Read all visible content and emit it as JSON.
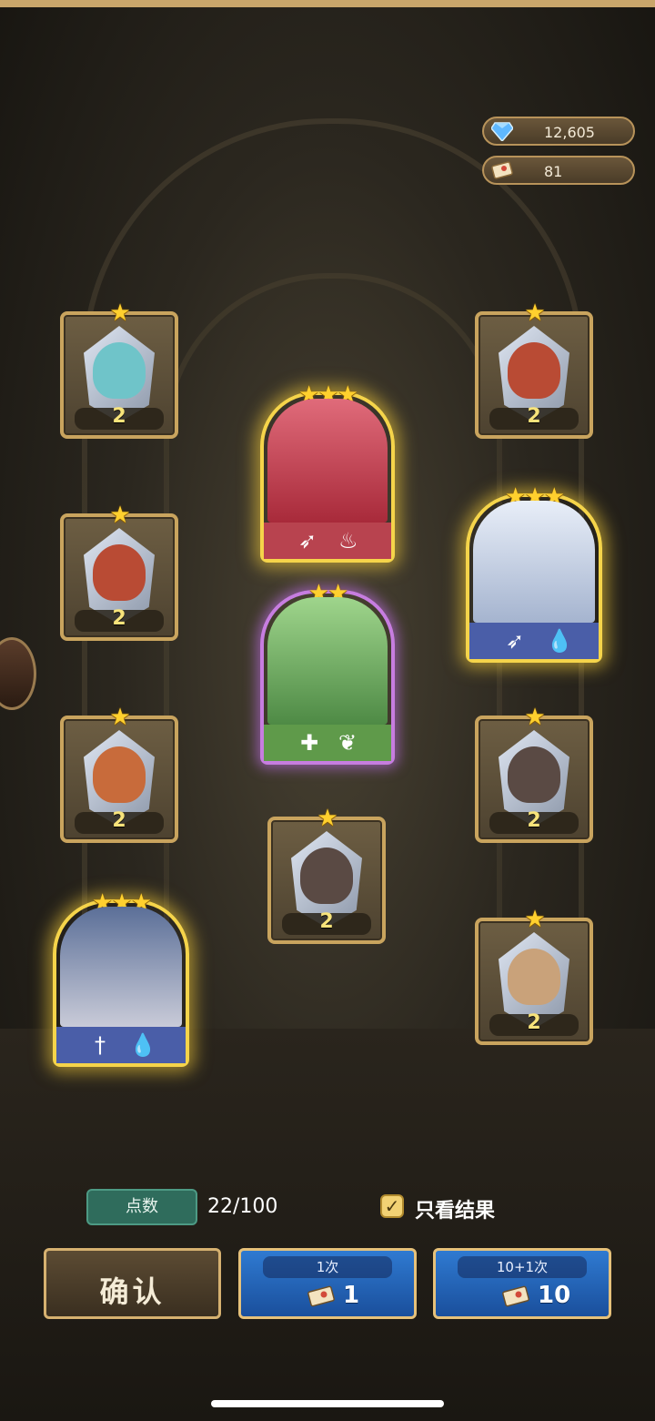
{
  "currency": {
    "gems": {
      "icon": "diamond-icon",
      "value": "12,605"
    },
    "tickets": {
      "icon": "ticket-icon",
      "value": "81"
    }
  },
  "heroes": [
    {
      "id": "h1",
      "stars": "★",
      "count": "2",
      "color": "#6fc4c9",
      "type": "shard"
    },
    {
      "id": "h2",
      "stars": "★",
      "count": "2",
      "color": "#b94b34",
      "type": "shard"
    },
    {
      "id": "h3",
      "stars": "★",
      "count": "2",
      "color": "#b94b34",
      "type": "shard"
    },
    {
      "id": "h4",
      "stars": "★",
      "count": "2",
      "color": "#c86b3b",
      "type": "shard"
    },
    {
      "id": "h5",
      "stars": "★",
      "count": "2",
      "color": "#5a4a44",
      "type": "shard"
    },
    {
      "id": "h6",
      "stars": "★",
      "count": "2",
      "color": "#5a4a44",
      "type": "shard"
    },
    {
      "id": "h7",
      "stars": "★",
      "count": "2",
      "color": "#c9a27a",
      "type": "shard"
    },
    {
      "id": "big1",
      "stars": "★★★",
      "color": "#d23a4a",
      "class_icons": [
        "bow-icon",
        "fire-icon"
      ]
    },
    {
      "id": "big2",
      "stars": "★★★",
      "color": "#c9d6ea",
      "class_icons": [
        "bow-icon",
        "water-icon"
      ]
    },
    {
      "id": "big3",
      "stars": "★★",
      "color": "#6fb06a",
      "class_icons": [
        "plus-icon",
        "leaf-icon"
      ]
    },
    {
      "id": "big4",
      "stars": "★★★",
      "color": "#8aa0c8",
      "class_icons": [
        "sword-icon",
        "water-icon"
      ]
    }
  ],
  "points": {
    "label": "点数",
    "value": "22/100"
  },
  "only_result": {
    "label": "只看结果",
    "checked": true
  },
  "buttons": {
    "confirm": "确认",
    "pull_1": {
      "caption": "1次",
      "cost": "1"
    },
    "pull_10": {
      "caption": "10+1次",
      "cost": "10"
    }
  }
}
